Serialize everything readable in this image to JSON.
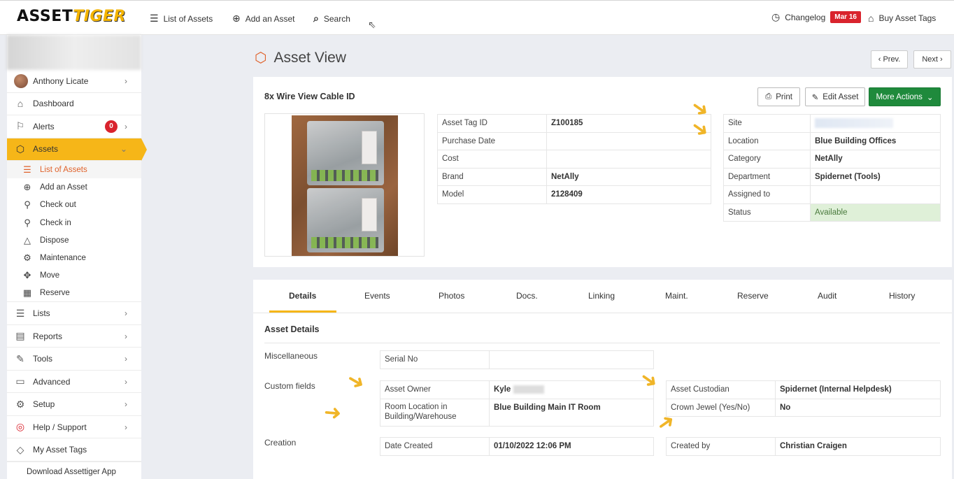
{
  "topbar": {
    "logo_part1": "ASSET",
    "logo_part2": "TIGER",
    "list_of_assets": "List of Assets",
    "add_an_asset": "Add an Asset",
    "search": "Search",
    "changelog": "Changelog",
    "changelog_date": "Mar 16",
    "buy_asset_tags": "Buy Asset Tags"
  },
  "sidebar": {
    "user": "Anthony Licate",
    "dashboard": "Dashboard",
    "alerts": "Alerts",
    "alerts_count": "0",
    "assets": "Assets",
    "sub": {
      "list_of_assets": "List of Assets",
      "add_an_asset": "Add an Asset",
      "check_out": "Check out",
      "check_in": "Check in",
      "dispose": "Dispose",
      "maintenance": "Maintenance",
      "move": "Move",
      "reserve": "Reserve"
    },
    "lists": "Lists",
    "reports": "Reports",
    "tools": "Tools",
    "advanced": "Advanced",
    "setup": "Setup",
    "help": "Help / Support",
    "my_asset_tags": "My Asset Tags",
    "download": "Download Assettiger App"
  },
  "header": {
    "title": "Asset View",
    "prev": "Prev.",
    "next": "Next"
  },
  "asset": {
    "name": "8x Wire View Cable ID",
    "print": "Print",
    "edit": "Edit Asset",
    "more_actions": "More Actions",
    "left_table": {
      "asset_tag_id_label": "Asset Tag ID",
      "asset_tag_id": "Z100185",
      "purchase_date_label": "Purchase Date",
      "purchase_date": "",
      "cost_label": "Cost",
      "cost": "",
      "brand_label": "Brand",
      "brand": "NetAlly",
      "model_label": "Model",
      "model": "2128409"
    },
    "right_table": {
      "site_label": "Site",
      "location_label": "Location",
      "location": "Blue Building Offices",
      "category_label": "Category",
      "category": "NetAlly",
      "department_label": "Department",
      "department": "Spidernet (Tools)",
      "assigned_to_label": "Assigned to",
      "assigned_to": "",
      "status_label": "Status",
      "status": "Available"
    }
  },
  "tabs": {
    "details": "Details",
    "events": "Events",
    "photos": "Photos",
    "docs": "Docs.",
    "linking": "Linking",
    "maint": "Maint.",
    "reserve": "Reserve",
    "audit": "Audit",
    "history": "History"
  },
  "details": {
    "title": "Asset Details",
    "miscellaneous": "Miscellaneous",
    "serial_no_label": "Serial No",
    "custom_fields": "Custom fields",
    "asset_owner_label": "Asset Owner",
    "asset_owner": "Kyle",
    "room_location_label": "Room Location in Building/Warehouse",
    "room_location": "Blue Building Main IT Room",
    "asset_custodian_label": "Asset Custodian",
    "asset_custodian": "Spidernet (Internal Helpdesk)",
    "crown_jewel_label": "Crown Jewel (Yes/No)",
    "crown_jewel": "No",
    "creation": "Creation",
    "date_created_label": "Date Created",
    "date_created": "01/10/2022 12:06 PM",
    "created_by_label": "Created by",
    "created_by": "Christian Craigen"
  },
  "colors": {
    "accent": "#f6b618",
    "brand_orange": "#e0622b",
    "green_button": "#1f8a3c",
    "badge_red": "#d9232d",
    "status_bg": "#dff0d8"
  }
}
